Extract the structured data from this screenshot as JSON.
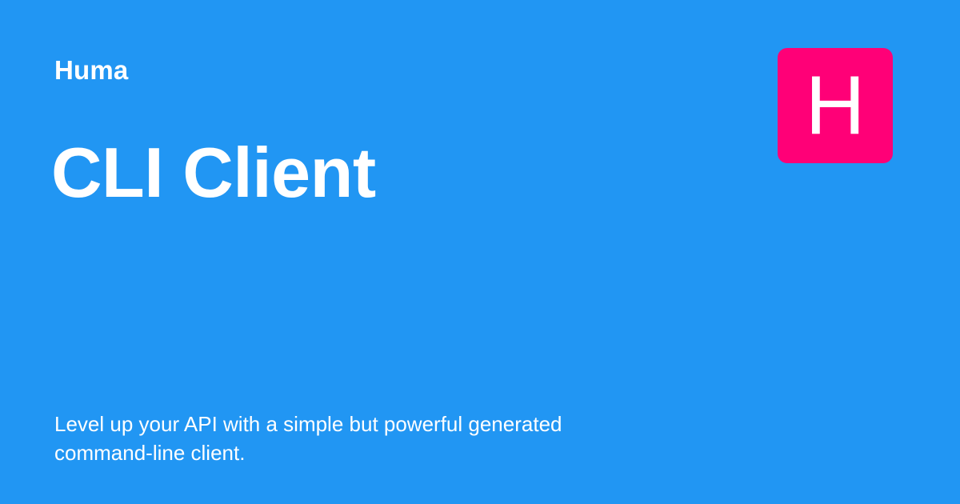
{
  "site": {
    "name": "Huma"
  },
  "page": {
    "title": "CLI Client",
    "description": "Level up your API with a simple but powerful generated command-line client."
  },
  "logo": {
    "letter": "H",
    "icon": "huma-logo-icon"
  },
  "colors": {
    "background": "#2196f3",
    "logo_background": "#ff0077",
    "text": "#ffffff"
  }
}
